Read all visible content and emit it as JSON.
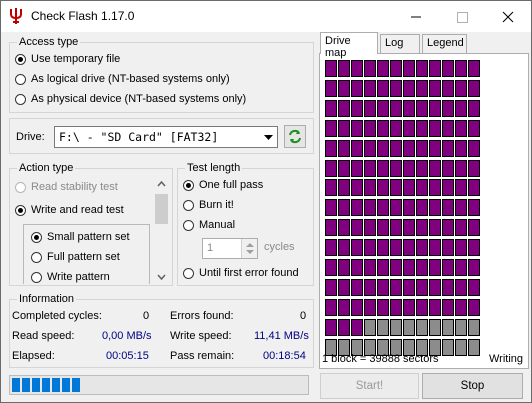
{
  "window": {
    "title": "Check Flash 1.17.0"
  },
  "access_type": {
    "legend": "Access type",
    "options": [
      {
        "label": "Use temporary file",
        "selected": true
      },
      {
        "label": "As logical drive (NT-based systems only)",
        "selected": false
      },
      {
        "label": "As physical device (NT-based systems only)",
        "selected": false
      }
    ]
  },
  "drive": {
    "label": "Drive:",
    "value": "F:\\ - \"SD Card\" [FAT32]"
  },
  "action_type": {
    "legend": "Action type",
    "options": [
      {
        "label": "Read stability test",
        "selected": false,
        "enabled": false
      },
      {
        "label": "Write and read test",
        "selected": true,
        "enabled": true
      }
    ],
    "patterns": [
      {
        "label": "Small pattern set",
        "selected": true
      },
      {
        "label": "Full pattern set",
        "selected": false
      },
      {
        "label": "Write pattern",
        "selected": false
      }
    ]
  },
  "test_length": {
    "legend": "Test length",
    "options": [
      {
        "label": "One full pass",
        "selected": true
      },
      {
        "label": "Burn it!",
        "selected": false
      },
      {
        "label": "Manual",
        "selected": false
      },
      {
        "label": "Until first error found",
        "selected": false
      }
    ],
    "cycles_value": "1",
    "cycles_label": "cycles"
  },
  "information": {
    "legend": "Information",
    "completed_cycles_label": "Completed cycles:",
    "completed_cycles": "0",
    "errors_found_label": "Errors found:",
    "errors_found": "0",
    "read_speed_label": "Read speed:",
    "read_speed": "0,00 MB/s",
    "write_speed_label": "Write speed:",
    "write_speed": "11,41 MB/s",
    "elapsed_label": "Elapsed:",
    "elapsed": "00:05:15",
    "pass_remain_label": "Pass remain:",
    "pass_remain": "00:18:54"
  },
  "progress": {
    "fraction": 0.24,
    "color": "#0078d7"
  },
  "tabs": [
    {
      "label": "Drive map",
      "active": true
    },
    {
      "label": "Log",
      "active": false
    },
    {
      "label": "Legend",
      "active": false
    }
  ],
  "drive_map": {
    "columns": 12,
    "rows": 15,
    "done_rows": 13,
    "last_row_pending": 12,
    "pending_start_col": 3,
    "done_color": "#800080",
    "pending_color": "#8c8c8c",
    "block_info": "1 block = 39888 sectors",
    "status": "Writing"
  },
  "buttons": {
    "start": "Start!",
    "stop": "Stop"
  },
  "icons": {
    "app": "flash-icon",
    "refresh": "refresh-icon",
    "dropdown": "chevron-down-icon"
  }
}
